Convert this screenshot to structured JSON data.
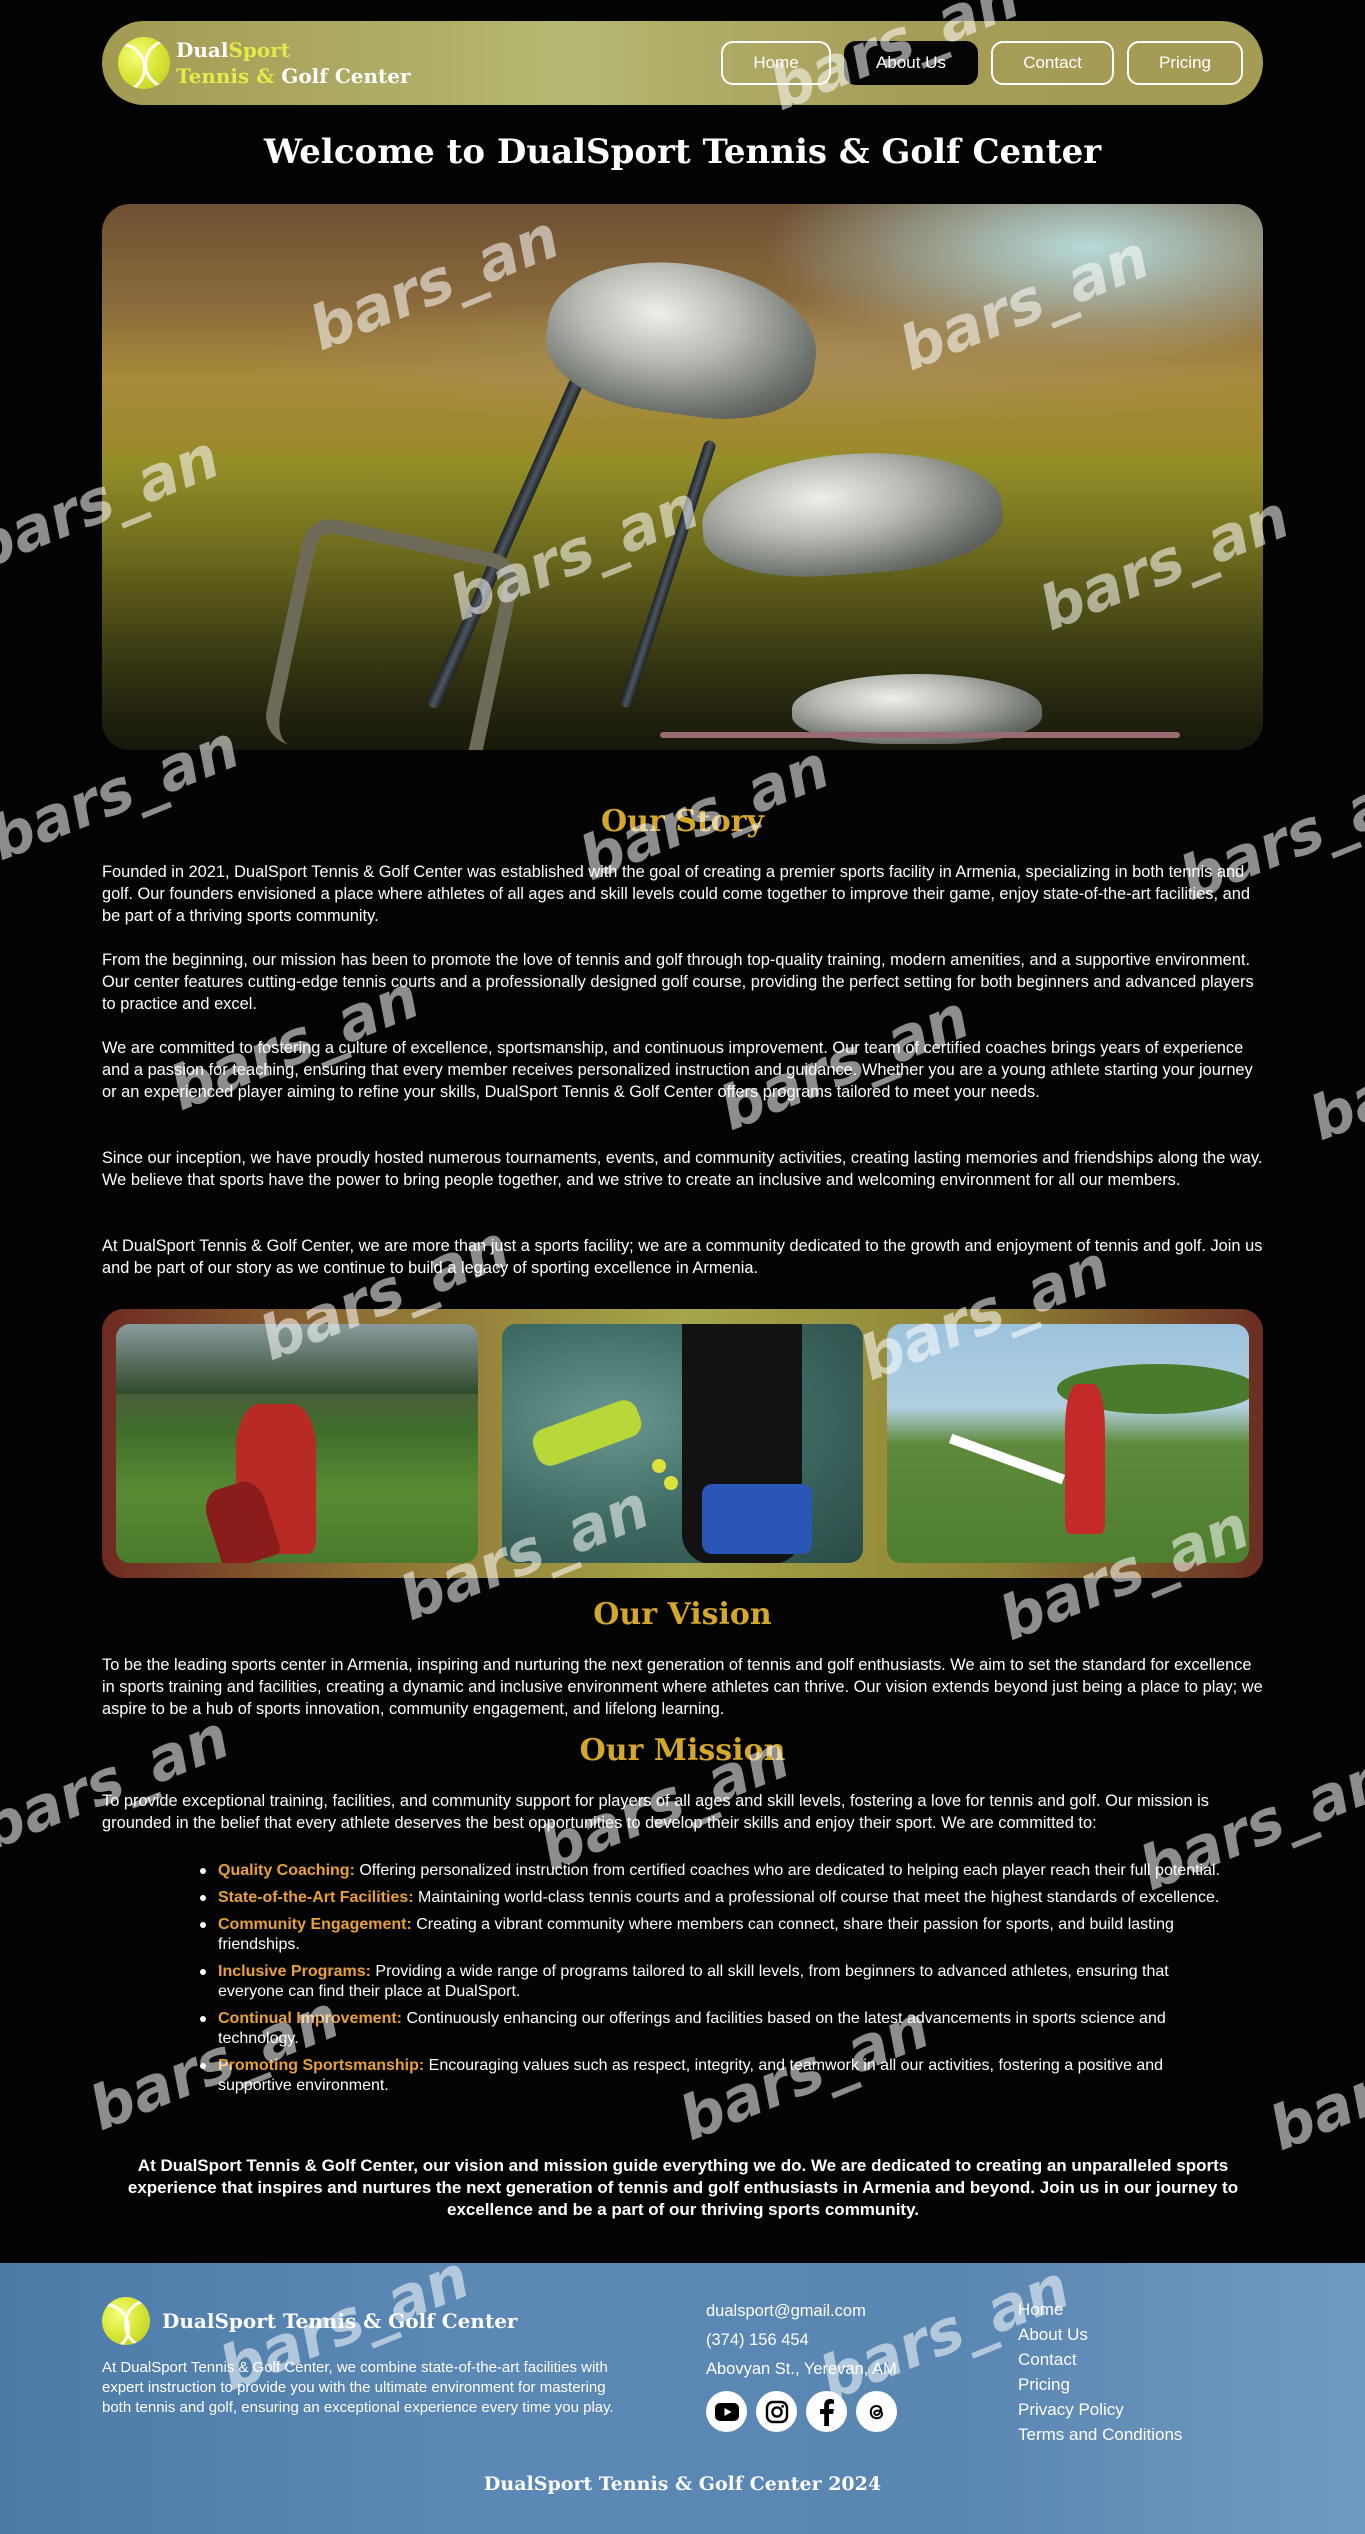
{
  "nav": {
    "logo": {
      "line1_a": "Dual",
      "line1_b": "Sport",
      "line2_a": "Tennis & ",
      "line2_b": "Golf Center"
    },
    "links": [
      {
        "label": "Home"
      },
      {
        "label": "About Us"
      },
      {
        "label": "Contact"
      },
      {
        "label": "Pricing"
      }
    ],
    "active": "About Us"
  },
  "page_title": "Welcome to DualSport Tennis & Golf Center",
  "story": {
    "title": "Our Story",
    "paragraphs": [
      "Founded in 2021, DualSport Tennis & Golf Center was established with the goal of creating a premier sports facility in Armenia, specializing in both tennis and golf. Our founders envisioned a place where athletes of all ages and skill levels could come together to improve their game, enjoy state-of-the-art facilities, and be part of a thriving sports community.",
      "From the beginning, our mission has been to promote the love of tennis and golf through top-quality training, modern amenities, and a supportive environment. Our center features cutting-edge tennis courts and a professionally designed golf course, providing the perfect setting for both beginners and advanced players to practice and excel.",
      "We are committed to fostering a culture of excellence, sportsmanship, and continuous improvement. Our team of certified coaches brings years of experience and a passion for teaching, ensuring that every member receives personalized instruction and guidance. Whether you are a young athlete starting your journey or an experienced player aiming to refine your skills, DualSport Tennis & Golf Center offers programs tailored to meet your needs.",
      "Since our inception, we have proudly hosted numerous tournaments, events, and community activities, creating lasting memories and friendships along the way. We believe that sports have the power to bring people together, and we strive to create an inclusive and welcoming environment for all our members.",
      "At DualSport Tennis & Golf Center, we are more than just a sports facility; we are a community dedicated to the growth and enjoyment of tennis and golf. Join us and be part of our story as we continue to build a legacy of sporting excellence in Armenia."
    ]
  },
  "vision": {
    "title": "Our Vision",
    "text": "To be the leading sports center in Armenia, inspiring and nurturing the next generation of tennis and golf enthusiasts. We aim to set the standard for excellence in sports training and facilities, creating a dynamic and inclusive environment where athletes can thrive. Our vision extends beyond just being a place to play; we aspire to be a hub of sports innovation, community engagement, and lifelong learning."
  },
  "mission": {
    "title": "Our Mission",
    "intro": "To provide exceptional training, facilities, and community support for players of all ages and skill levels, fostering a love for tennis and golf. Our mission is grounded in the belief that every athlete deserves the best opportunities to develop their skills and enjoy their sport. We are committed to:",
    "items": [
      {
        "label": "Quality Coaching:",
        "text": " Offering personalized instruction from certified coaches who are dedicated to helping each player reach their full potential."
      },
      {
        "label": "State-of-the-Art Facilities:",
        "text": " Maintaining world-class tennis courts and a professional olf course that meet the highest standards of excellence."
      },
      {
        "label": "Community Engagement:",
        "text": " Creating a vibrant community where members can connect, share their passion for sports, and build lasting friendships."
      },
      {
        "label": "Inclusive Programs:",
        "text": " Providing a wide range of programs tailored to all skill levels, from beginners to advanced athletes, ensuring that everyone can find their place at DualSport."
      },
      {
        "label": "Continual Improvement:",
        "text": " Continuously enhancing our offerings and facilities based on the latest advancements in sports science and technology."
      },
      {
        "label": "Promoting Sportsmanship:",
        "text": " Encouraging values such as respect, integrity, and teamwork in all our activities, fostering a positive and supportive environment."
      }
    ],
    "closing": "At DualSport Tennis & Golf Center, our vision and mission guide everything we do. We are dedicated to creating an unparalleled sports experience that inspires and nurtures the next generation of tennis and golf enthusiasts in Armenia and beyond. Join us in our journey to excellence and be a part of our thriving sports community."
  },
  "footer": {
    "brand": "DualSport Tennis & Golf Center",
    "description": "At DualSport Tennis & Golf Center, we combine state-of-the-art facilities with expert instruction to provide you with the ultimate environment for mastering both tennis and golf, ensuring an exceptional experience every time you play.",
    "email": "dualsport@gmail.com",
    "phone": "(374) 156 454",
    "address": "Abovyan St., Yerevan, AM",
    "socials": [
      "youtube-icon",
      "instagram-icon",
      "facebook-icon",
      "threads-icon"
    ],
    "links": [
      "Home",
      "About Us",
      "Contact",
      "Pricing",
      "Privacy Policy",
      "Terms and Conditions"
    ],
    "copyright": "DualSport Tennis & Golf Center 2024"
  },
  "watermark": "bars_an",
  "colors": {
    "accent": "#d4a62a",
    "highlight": "#e8a03a",
    "footer": "#5a86b2",
    "background": "#030303"
  }
}
